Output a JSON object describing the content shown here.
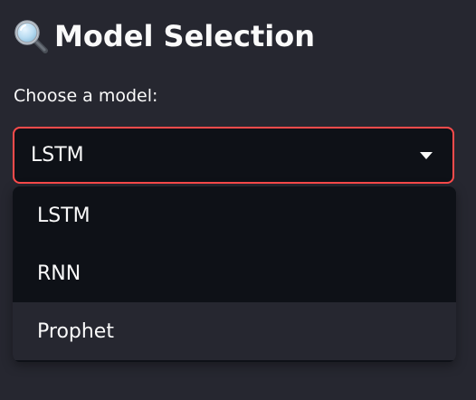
{
  "header": {
    "icon": "magnifier-icon",
    "title": "Model Selection"
  },
  "select": {
    "label": "Choose a model:",
    "value": "LSTM",
    "options": [
      "LSTM",
      "RNN",
      "Prophet"
    ],
    "highlighted_option": "Prophet"
  },
  "colors": {
    "background": "#262730",
    "input_background": "#0e1117",
    "focus_border": "#ff4b4b",
    "text": "#fafafa",
    "hover_background": "#262730"
  }
}
